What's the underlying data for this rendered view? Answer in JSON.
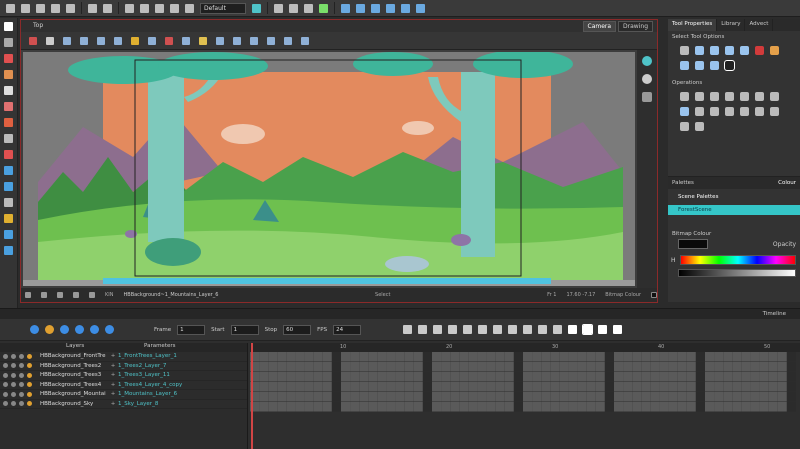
{
  "toolbar": {
    "preset": "Default"
  },
  "camera": {
    "title": "Top",
    "tabs": [
      "Camera",
      "Drawing"
    ],
    "status": {
      "zoom": "KIN",
      "layer": "HBBackground~1_Mountains_Layer_6",
      "mode": "Select",
      "frame": "Fr 1",
      "coords": "17.60 -7.17",
      "bitmap": "Bitmap Colour"
    }
  },
  "tool_properties": {
    "tabs": [
      "Tool Properties",
      "Library",
      "Advect"
    ],
    "select_options": "Select Tool Options",
    "operations": "Operations"
  },
  "colour_panel": {
    "title": "Colour",
    "palettes": "Palettes",
    "scene_palettes": "Scene Palettes",
    "palette_item": "ForestScene",
    "bitmap_colour": "Bitmap Colour",
    "opacity": "Opacity",
    "hue_label": "H"
  },
  "timeline": {
    "title": "Timeline",
    "frame_label": "Frame",
    "frame_value": "1",
    "start_label": "Start",
    "start_value": "1",
    "stop_label": "Stop",
    "stop_value": "60",
    "fps_label": "FPS",
    "fps_value": "24",
    "layers_header": "Layers",
    "params_header": "Parameters",
    "ruler": [
      "10",
      "20",
      "30",
      "40",
      "50"
    ],
    "layers": [
      {
        "name": "HBBackground_FrontTre",
        "param": "1_FrontTrees_Layer_1"
      },
      {
        "name": "HBBackground_Trees2",
        "param": "1_Trees2_Layer_7"
      },
      {
        "name": "HBBackground_Trees3",
        "param": "1_Trees3_Layer_11"
      },
      {
        "name": "HBBackground_Trees4",
        "param": "1_Trees4_Layer_4_copy"
      },
      {
        "name": "HBBackground_Mountai",
        "param": "1_Mountains_Layer_6"
      },
      {
        "name": "HBBackground_Sky",
        "param": "1_Sky_Layer_8"
      }
    ]
  }
}
